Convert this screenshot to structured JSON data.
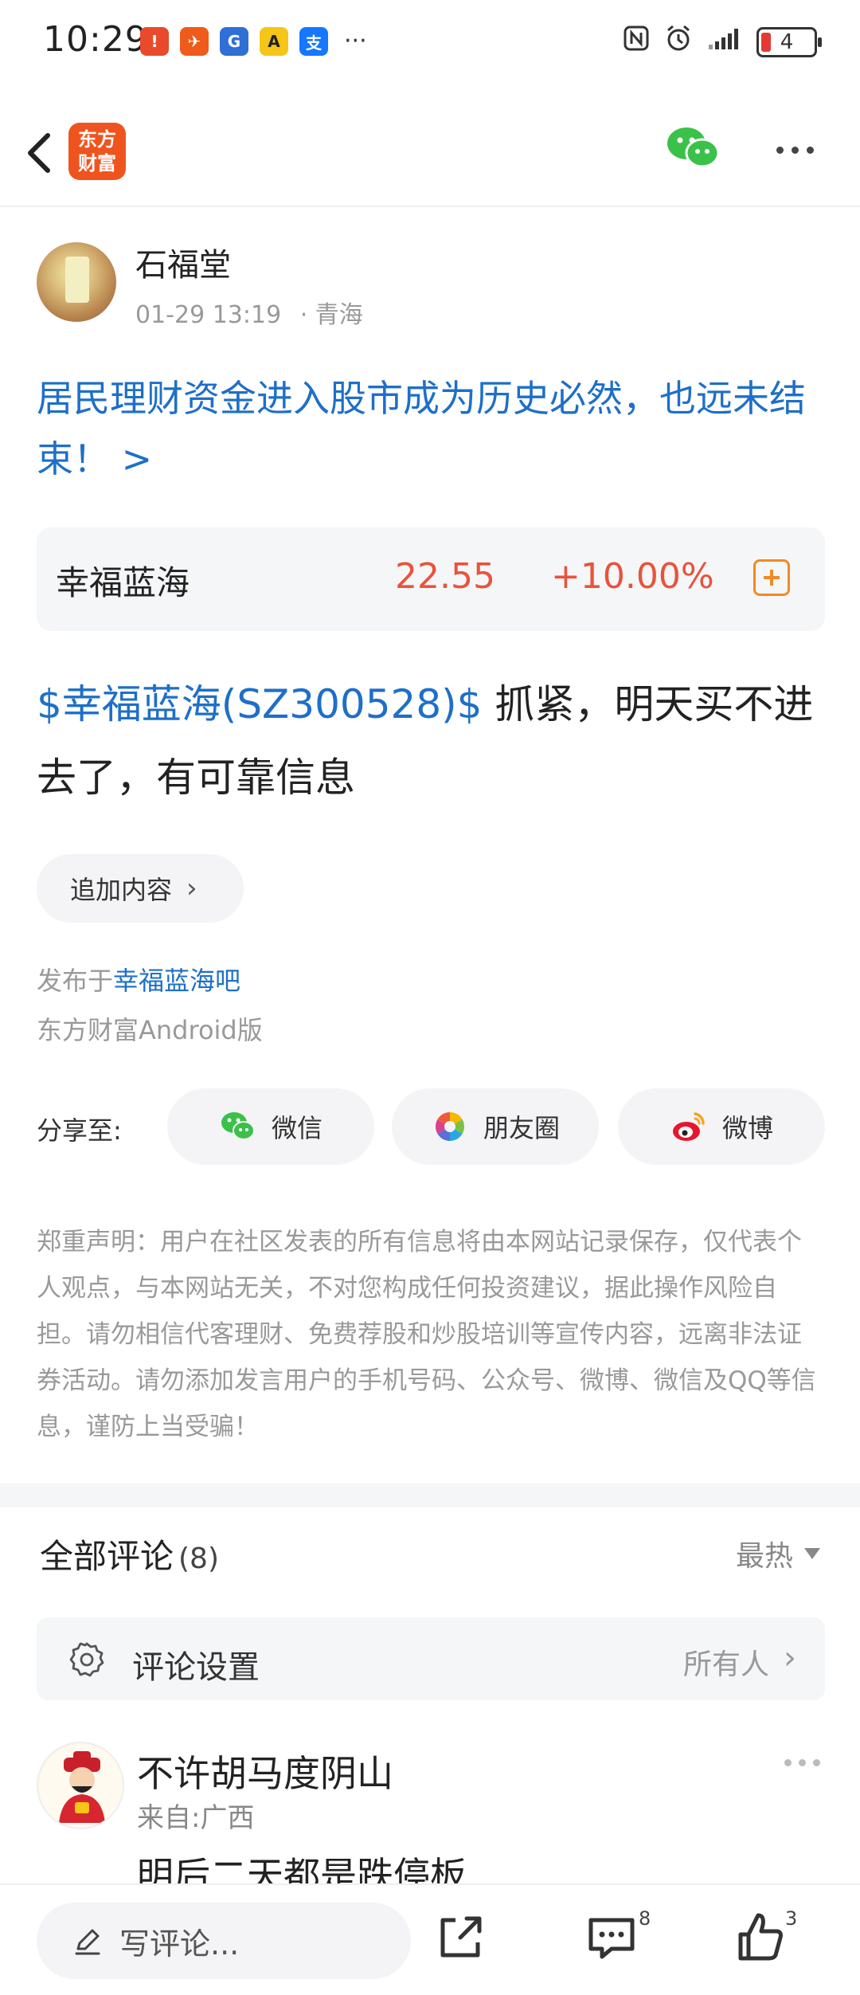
{
  "status_bar": {
    "time": "10:29",
    "dots": "···",
    "battery": "4"
  },
  "nav": {
    "logo_text": "东方财富"
  },
  "author": {
    "name": "石福堂",
    "time": "01-29 13:19",
    "location": "· 青海"
  },
  "headline": "居民理财资金进入股市成为历史必然，也远未结束！ >",
  "stock": {
    "name": "幸福蓝海",
    "price": "22.55",
    "change": "+10.00%"
  },
  "post": {
    "tag": "$幸福蓝海(SZ300528)$",
    "text": " 抓紧，明天买不进去了，有可靠信息"
  },
  "append_button": "追加内容",
  "published": {
    "prefix": "发布于",
    "bar": "幸福蓝海吧"
  },
  "client": "东方财富Android版",
  "share": {
    "label": "分享至:",
    "wechat": "微信",
    "moments": "朋友圈",
    "weibo": "微博"
  },
  "disclaimer": "郑重声明：用户在社区发表的所有信息将由本网站记录保存，仅代表个人观点，与本网站无关，不对您构成任何投资建议，据此操作风险自担。请勿相信代客理财、免费荐股和炒股培训等宣传内容，远离非法证券活动。请勿添加发言用户的手机号码、公众号、微博、微信及QQ等信息，谨防上当受骗！",
  "comments": {
    "title": "全部评论",
    "count": "(8)",
    "sort": "最热",
    "settings_label": "评论设置",
    "settings_value": "所有人",
    "items": [
      {
        "name": "不许胡马度阴山",
        "from": "来自:广西",
        "text": "明后二天都是跌停板"
      }
    ]
  },
  "bottom_bar": {
    "write_placeholder": "写评论...",
    "comment_count": "8",
    "like_count": "3"
  },
  "colors": {
    "link_blue": "#1e6fc8",
    "stock_red": "#e8533c",
    "brand_orange": "#f0541e"
  }
}
